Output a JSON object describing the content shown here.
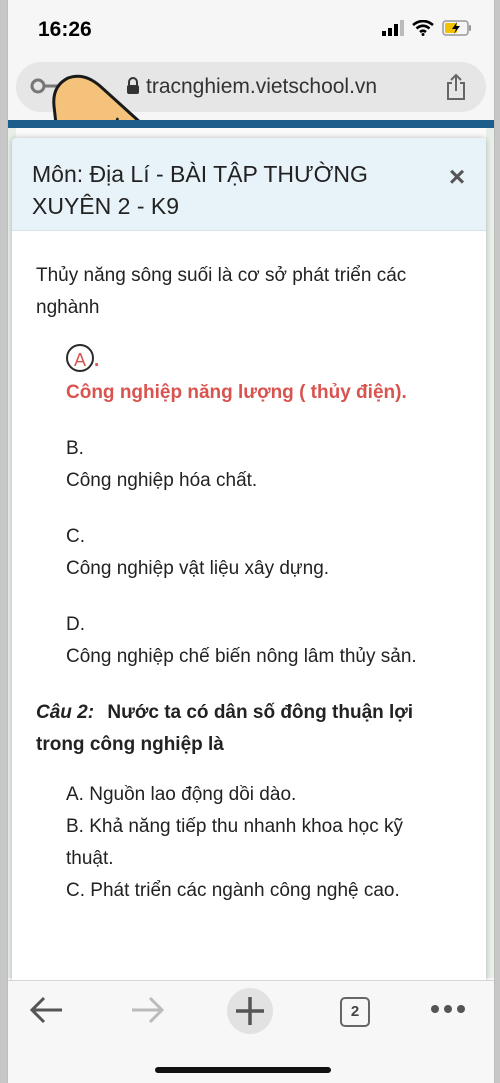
{
  "status_bar": {
    "time": "16:26"
  },
  "browser": {
    "url": "tracnghiem.vietschool.vn",
    "tab_count": "2"
  },
  "modal": {
    "title": "Môn: Địa Lí - BÀI TẬP THƯỜNG XUYÊN 2 - K9",
    "close_label": "×",
    "question": "Thủy năng sông suối là cơ sở phát triển các nghành",
    "options": [
      {
        "letter": "A",
        "suffix": ".",
        "text": "Công nghiệp năng lượng ( thủy điện)."
      },
      {
        "letter": "B.",
        "text": "Công nghiệp hóa chất."
      },
      {
        "letter": "C.",
        "text": "Công nghiệp vật liệu xây dựng."
      },
      {
        "letter": "D.",
        "text": "Công nghiệp chế biến nông lâm thủy sản."
      }
    ],
    "question2": {
      "label": "Câu 2:",
      "text": "Nước ta có dân số đông thuận lợi trong công nghiệp là",
      "options": [
        "A. Nguồn lao động dồi dào.",
        "B. Khả năng tiếp thu nhanh khoa học kỹ thuật.",
        "C. Phát triển các ngành công nghệ cao."
      ]
    }
  },
  "colors": {
    "correct": "#d9534f",
    "header_bg": "#e8f2f9",
    "page_stripe": "#1d5d8b"
  }
}
